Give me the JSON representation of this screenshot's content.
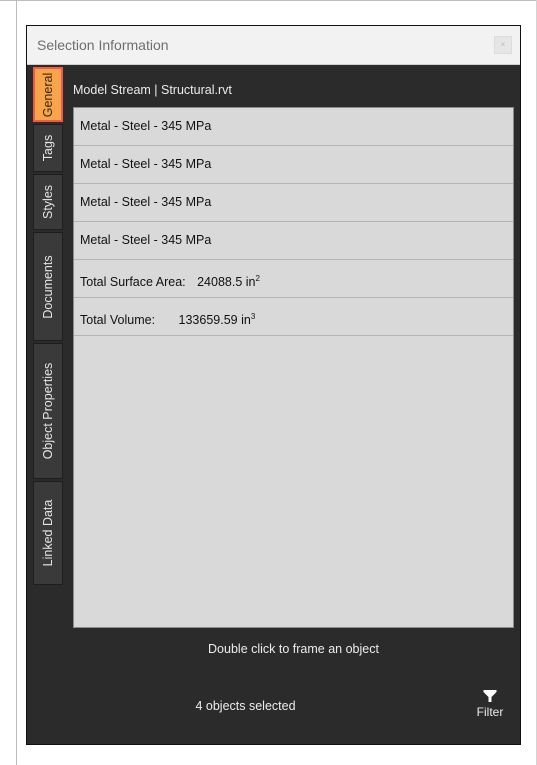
{
  "panel": {
    "title": "Selection Information",
    "close_glyph": "×"
  },
  "tabs": [
    {
      "label": "General",
      "active": true
    },
    {
      "label": "Tags",
      "active": false
    },
    {
      "label": "Styles",
      "active": false
    },
    {
      "label": "Documents",
      "active": false
    },
    {
      "label": "Object Properties",
      "active": false
    },
    {
      "label": "Linked Data",
      "active": false
    }
  ],
  "content": {
    "file_label": "Model Stream | Structural.rvt",
    "items": [
      {
        "label": "Metal - Steel - 345 MPa"
      },
      {
        "label": "Metal - Steel - 345 MPa"
      },
      {
        "label": "Metal - Steel - 345 MPa"
      },
      {
        "label": "Metal - Steel - 345 MPa"
      }
    ],
    "surface_area": {
      "label": "Total Surface Area:",
      "value": "24088.5 in",
      "unit_exp": "2"
    },
    "volume": {
      "label": "Total Volume:",
      "value": "133659.59 in",
      "unit_exp": "3"
    },
    "hint": "Double click to frame an object",
    "status": "4 objects selected",
    "filter_label": "Filter",
    "filter_icon": "funnel-icon"
  },
  "colors": {
    "panel_bg": "#2b2b2b",
    "active_tab": "#f7a44a",
    "active_tab_border": "#ef5b4a",
    "list_bg": "#d9d9d9"
  }
}
